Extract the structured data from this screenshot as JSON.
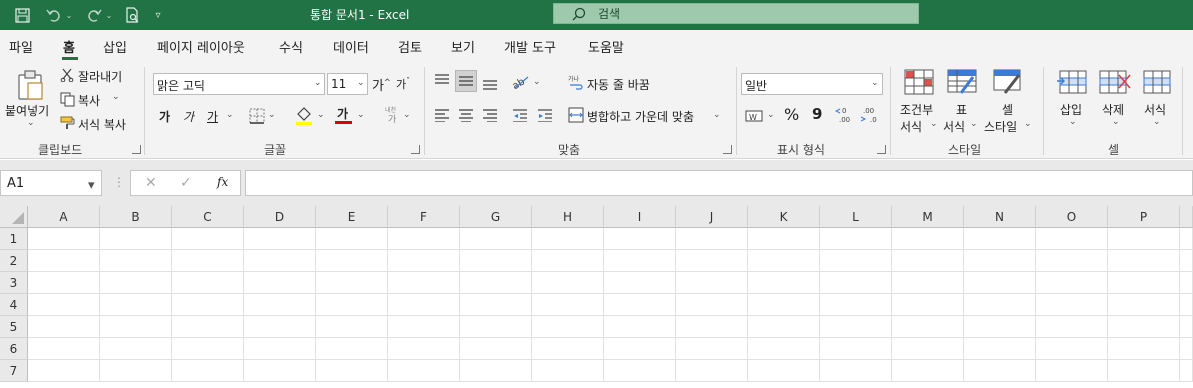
{
  "titlebar": {
    "title": "통합 문서1  -  Excel",
    "search_label": "검색",
    "color": "#217346"
  },
  "menu": {
    "tabs": [
      "파일",
      "홈",
      "삽입",
      "페이지 레이아웃",
      "수식",
      "데이터",
      "검토",
      "보기",
      "개발 도구",
      "도움말"
    ],
    "active": "홈"
  },
  "clipboard": {
    "paste": "붙여넣기",
    "cut": "잘라내기",
    "copy": "복사",
    "format_painter": "서식 복사",
    "label": "클립보드"
  },
  "font": {
    "family": "맑은 고딕",
    "size": "11",
    "bold": "가",
    "italic": "가",
    "underline": "가",
    "font_color_glyph": "가",
    "label": "글꼴"
  },
  "alignment": {
    "wrap_text": "자동 줄 바꿈",
    "merge_center": "병합하고 가운데 맞춤",
    "label": "맞춤"
  },
  "number": {
    "format": "일반",
    "percent": "%",
    "comma": "9",
    "label": "표시 형식"
  },
  "styles": {
    "conditional": [
      "조건부",
      "서식"
    ],
    "table": [
      "표",
      "서식"
    ],
    "cell": [
      "셀",
      "스타일"
    ],
    "label": "스타일"
  },
  "cells": {
    "insert": "삽입",
    "delete": "삭제",
    "format": "서식",
    "label": "셀"
  },
  "formula_bar": {
    "name_box": "A1",
    "fx": "fx",
    "value": ""
  },
  "sheet": {
    "columns": [
      "A",
      "B",
      "C",
      "D",
      "E",
      "F",
      "G",
      "H",
      "I",
      "J",
      "K",
      "L",
      "M",
      "N",
      "O",
      "P"
    ],
    "rows": [
      "1",
      "2",
      "3",
      "4",
      "5",
      "6",
      "7"
    ]
  }
}
